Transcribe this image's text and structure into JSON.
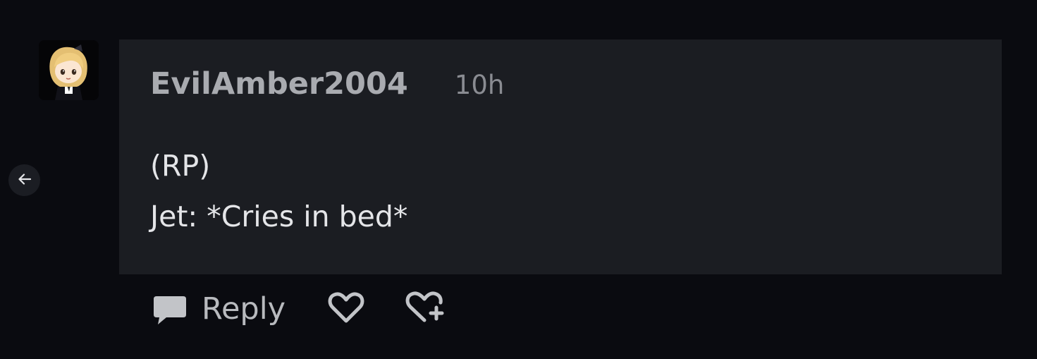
{
  "comment": {
    "username": "EvilAmber2004",
    "timestamp": "10h",
    "body_lines": [
      "(RP)",
      "Jet: *Cries in bed*"
    ]
  },
  "actions": {
    "reply_label": "Reply"
  },
  "icons": {
    "back": "arrow-left-icon",
    "reply": "speech-bubble-icon",
    "like": "heart-icon",
    "boost": "heart-plus-icon"
  },
  "colors": {
    "background": "#0a0b10",
    "bubble": "#1b1d22",
    "text": "#e4e5e8",
    "muted": "#a9abb0"
  }
}
